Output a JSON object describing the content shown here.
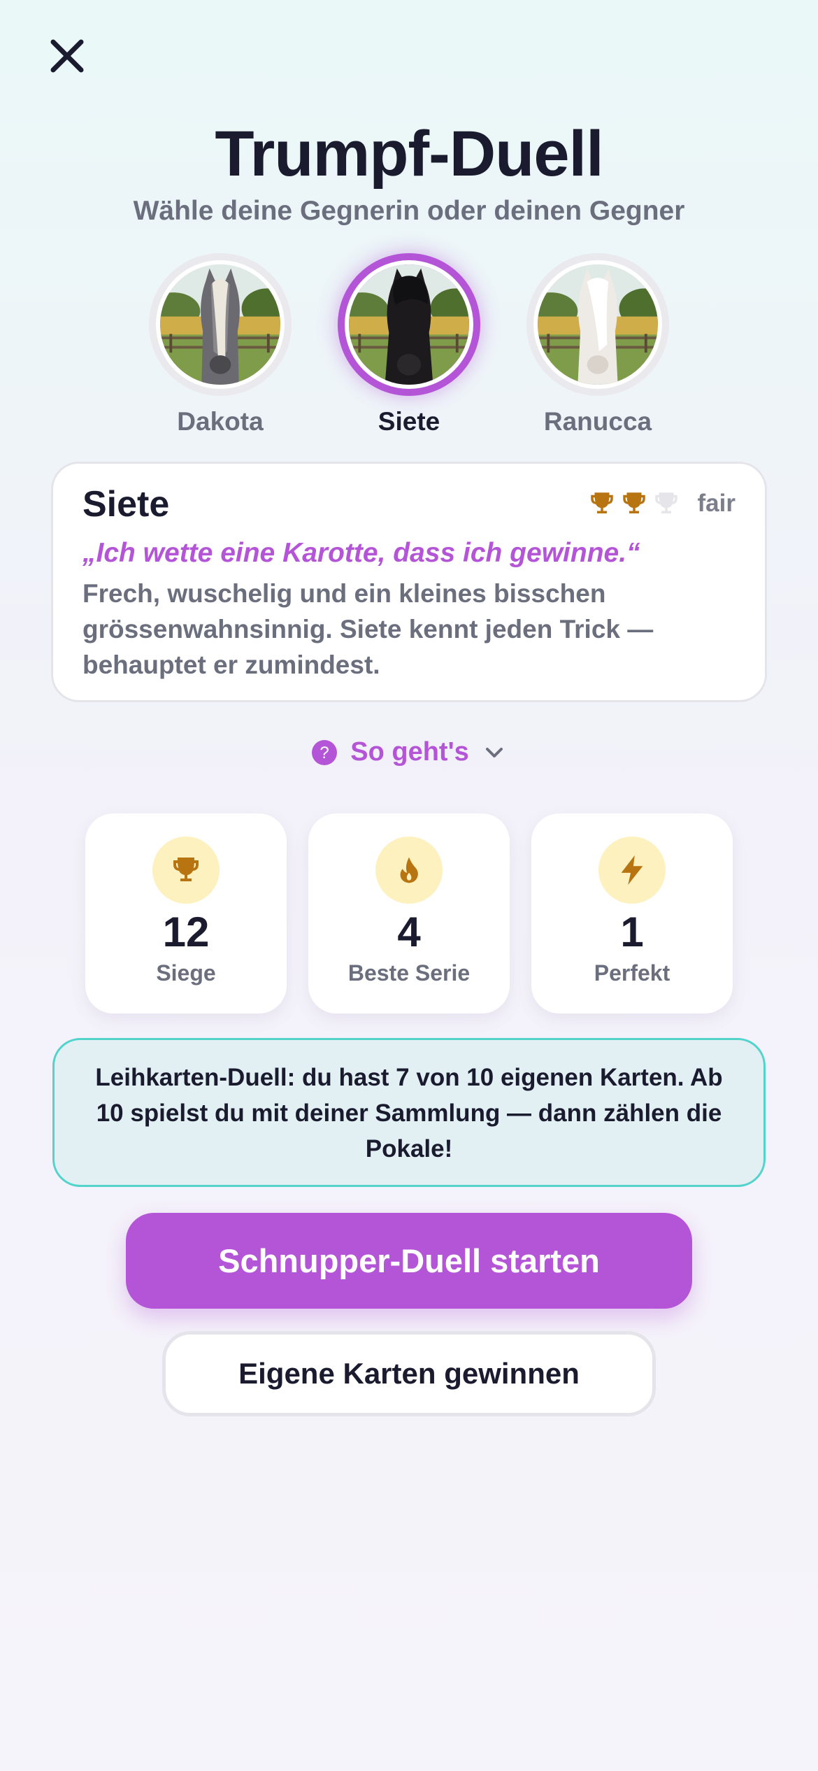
{
  "header": {
    "title": "Trumpf-Duell",
    "subtitle": "Wähle deine Gegnerin oder deinen Gegner"
  },
  "opponents": [
    {
      "name": "Dakota",
      "selected": false
    },
    {
      "name": "Siete",
      "selected": true
    },
    {
      "name": "Ranucca",
      "selected": false
    }
  ],
  "profile": {
    "name": "Siete",
    "difficulty_level": 2,
    "difficulty_max": 3,
    "difficulty_label": "fair",
    "quote": "„Ich wette eine Karotte, dass ich gewinne.“",
    "description": "Frech, wuschelig und ein kleines bisschen grössenwahnsinnig. Siete kennt jeden Trick — behauptet er zumindest."
  },
  "howto": {
    "label": "So geht's"
  },
  "stats": [
    {
      "value": "12",
      "label": "Siege",
      "icon": "trophy-icon"
    },
    {
      "value": "4",
      "label": "Beste Serie",
      "icon": "flame-icon"
    },
    {
      "value": "1",
      "label": "Perfekt",
      "icon": "lightning-icon"
    }
  ],
  "notice": {
    "text": "Leihkarten-Duell: du hast 7 von 10 eigenen Karten. Ab 10 spielst du mit deiner Sammlung — dann zählen die Pokale!"
  },
  "actions": {
    "primary_label": "Schnupper-Duell starten",
    "secondary_label": "Eigene Karten gewinnen"
  },
  "colors": {
    "accent": "#b455d8",
    "text_dark": "#1a1b2e",
    "text_muted": "#6b6f7d",
    "trophy_gold": "#b87410",
    "notice_border": "#52d3cb"
  }
}
